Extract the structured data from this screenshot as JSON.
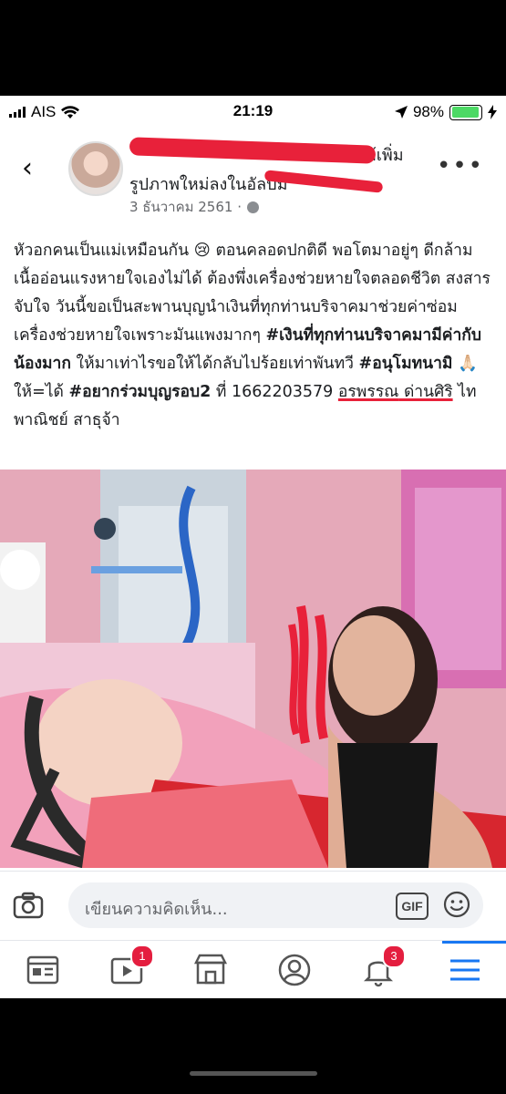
{
  "status_bar": {
    "carrier": "AIS",
    "time": "21:19",
    "battery": "98%"
  },
  "post": {
    "header_line1": "ได้เพิ่ม",
    "header_line2": "รูปภาพใหม่ลงในอัลบั้ม",
    "date": "3 ธันวาคม 2561 ·",
    "text": {
      "p1": "หัวอกคนเป็นแม่เหมือนกัน 😢 ตอนคลอดปกติดี พอโตมาอยู่ๆ ดีกล้ามเนื้ออ่อนแรงหายใจเองไม่ได้ ต้องพึ่งเครื่องช่วยหายใจตลอดชีวิต สงสารจับใจ วันนี้ขอเป็นสะพานบุญนำเงินที่ทุกท่านบริจาคมาช่วยค่าซ่อมเครื่องช่วยหายใจเพราะมันแพงมากๆ ",
      "tag1": "#เงินที่ทุกท่านบริจาคมามีค่ากับน้องมาก",
      "p2": " ให้มาเท่าไรขอให้ได้กลับไปร้อยเท่าพันทวี ",
      "tag2": "#อนุโมทนามิ",
      "p3": " 🙏🏻 ให้=ได้ ",
      "tag3": "#อยากร่วมบุญรอบ2",
      "p4": " ที่ 1662203579 ",
      "name": "อรพรรณ",
      "p5": " ด่านศิริ",
      "p6": " ไทพาณิชย์ สาธุจ้า"
    }
  },
  "comment_bar": {
    "placeholder": "เขียนความคิดเห็น...",
    "gif_label": "GIF"
  },
  "tabbar": {
    "video_badge": "1",
    "notifications_badge": "3"
  },
  "colors": {
    "accent": "#1877f2",
    "badge": "#e41e3f",
    "redaction": "#e8213a"
  }
}
